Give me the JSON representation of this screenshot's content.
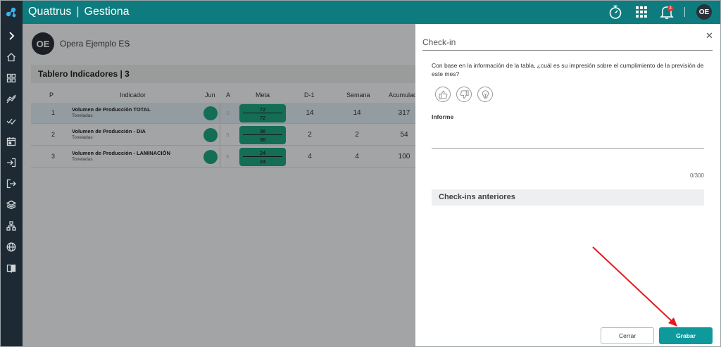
{
  "app": {
    "brand": "Quattrus",
    "product": "Gestiona"
  },
  "header": {
    "notification_count": "3",
    "user_initials": "OE"
  },
  "breadcrumb": {
    "initials": "OE",
    "label": "Opera Ejemplo ES"
  },
  "board": {
    "title": "Tablero Indicadores | 3",
    "columns": {
      "p": "P",
      "indicador": "Indicador",
      "jun": "Jun",
      "a": "A",
      "meta": "Meta",
      "d1": "D-1",
      "semana": "Semana",
      "acumulado": "Acumulado"
    },
    "rows": [
      {
        "p": "1",
        "name": "Volumen de Producción TOTAL",
        "unit": "Toneladas",
        "a": "s",
        "meta_top": "72",
        "meta_bottom": "72",
        "d1": "14",
        "semana": "14",
        "acumulado": "317"
      },
      {
        "p": "2",
        "name": "Volumen de Producción - DIA",
        "unit": "Toneladas",
        "a": "s",
        "meta_top": "36",
        "meta_bottom": "36",
        "d1": "2",
        "semana": "2",
        "acumulado": "54"
      },
      {
        "p": "3",
        "name": "Volumen de Producción - LAMINACIÓN",
        "unit": "Toneladas",
        "a": "s",
        "meta_top": "24",
        "meta_bottom": "24",
        "d1": "4",
        "semana": "4",
        "acumulado": "100"
      }
    ]
  },
  "checkin": {
    "title": "Check-in",
    "question": "Con base en la información de la tabla, ¿cuál es su impresión sobre el cumplimiento de la previsión de este mes?",
    "informe_label": "Informe",
    "informe_value": "",
    "counter": "0/300",
    "previous_label": "Check-ins anteriores",
    "cancel_label": "Cerrar",
    "save_label": "Grabar"
  },
  "colors": {
    "topbar": "#0e7c7e",
    "sidebar": "#1d2a33",
    "meta_green": "#1fa37f",
    "save_button": "#0e9a9c",
    "annotation_arrow": "#e8181e"
  }
}
